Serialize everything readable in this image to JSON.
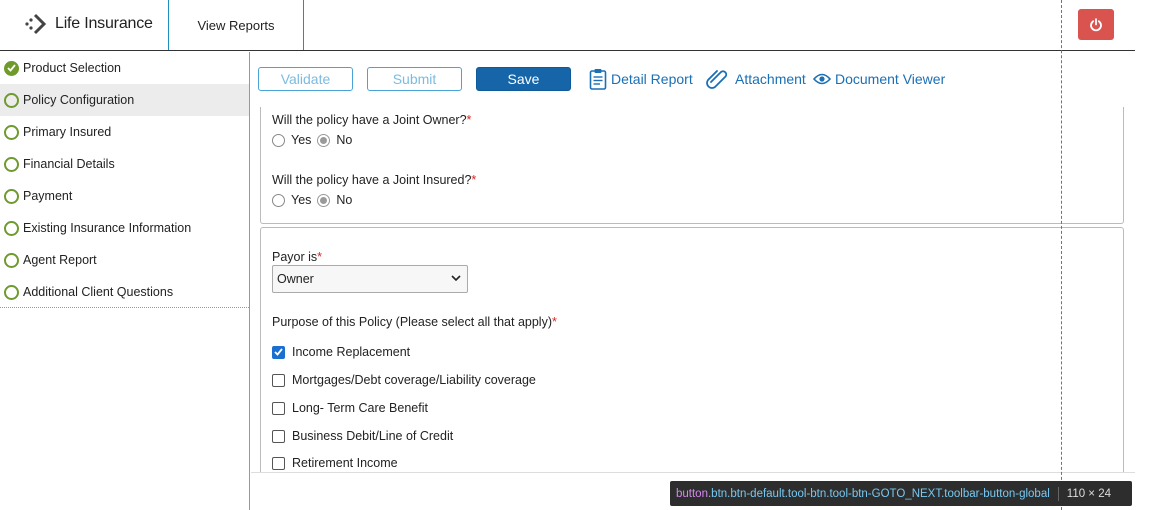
{
  "header": {
    "app_title": "Life Insurance",
    "nav_tab": "View Reports"
  },
  "sidebar": {
    "items": [
      {
        "label": "Product Selection",
        "status": "complete"
      },
      {
        "label": "Policy Configuration",
        "status": "active"
      },
      {
        "label": "Primary Insured",
        "status": "pending"
      },
      {
        "label": "Financial Details",
        "status": "pending"
      },
      {
        "label": "Payment",
        "status": "pending"
      },
      {
        "label": "Existing Insurance Information",
        "status": "pending"
      },
      {
        "label": "Agent Report",
        "status": "pending"
      },
      {
        "label": "Additional Client Questions",
        "status": "pending"
      }
    ]
  },
  "toolbar": {
    "validate_label": "Validate",
    "submit_label": "Submit",
    "save_label": "Save",
    "detail_report_label": "Detail Report",
    "attachment_label": "Attachment",
    "document_viewer_label": "Document Viewer"
  },
  "form": {
    "joint_owner": {
      "question": "Will the policy have a Joint Owner?",
      "required_mark": "*",
      "options": [
        "Yes",
        "No"
      ],
      "selected": "No"
    },
    "joint_insured": {
      "question": "Will the policy have a Joint Insured?",
      "required_mark": "*",
      "options": [
        "Yes",
        "No"
      ],
      "selected": "No"
    },
    "payor": {
      "label": "Payor is",
      "required_mark": "*",
      "selected_value": "Owner"
    },
    "purpose": {
      "label": "Purpose of this Policy (Please select all that apply)",
      "required_mark": "*",
      "options": [
        {
          "label": "Income Replacement",
          "checked": true
        },
        {
          "label": "Mortgages/Debt coverage/Liability coverage",
          "checked": false
        },
        {
          "label": "Long- Term Care Benefit",
          "checked": false
        },
        {
          "label": "Business Debit/Line of Credit",
          "checked": false
        },
        {
          "label": "Retirement Income",
          "checked": false
        }
      ]
    }
  },
  "devtools_tooltip": {
    "tag": "button",
    "classes": ".btn.btn-default.tool-btn.tool-btn-GOTO_NEXT.toolbar-button-global",
    "size": "110 × 24"
  },
  "colors": {
    "accent": "#1565a8",
    "check_green": "#6f9a2c",
    "power_red": "#d9534f",
    "required_red": "#e02020"
  }
}
